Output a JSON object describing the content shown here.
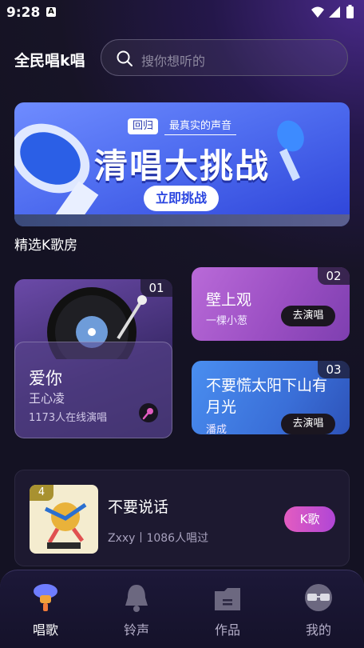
{
  "status_bar": {
    "time": "9:28",
    "notification_icon": "a-icon"
  },
  "header": {
    "app_title": "全民唱k唱",
    "search_placeholder": "搜你想听的"
  },
  "banner": {
    "tag_left": "回归",
    "tag_right": "最真实的声音",
    "title": "清唱大挑战",
    "cta_label": "立即挑战"
  },
  "section": {
    "title": "精选K歌房"
  },
  "rooms": [
    {
      "rank": "01",
      "song": "爱你",
      "artist": "王心凌",
      "online": "1173人在线演唱"
    },
    {
      "rank": "02",
      "song": "壁上观",
      "artist": "一棵小葱",
      "action": "去演唱"
    },
    {
      "rank": "03",
      "song": "不要慌太阳下山有月光",
      "artist": "潘成",
      "action": "去演唱"
    }
  ],
  "featured_song": {
    "rank": "4",
    "title": "不要说话",
    "meta": "Zxxy丨1086人唱过",
    "action": "K歌"
  },
  "bottom_nav": [
    {
      "label": "唱歌",
      "icon": "mic-icon",
      "active": true
    },
    {
      "label": "铃声",
      "icon": "bell-icon",
      "active": false
    },
    {
      "label": "作品",
      "icon": "folder-icon",
      "active": false
    },
    {
      "label": "我的",
      "icon": "glasses-avatar-icon",
      "active": false
    }
  ],
  "colors": {
    "accent": "#e35cc0",
    "banner_blue": "#4f6df0"
  }
}
